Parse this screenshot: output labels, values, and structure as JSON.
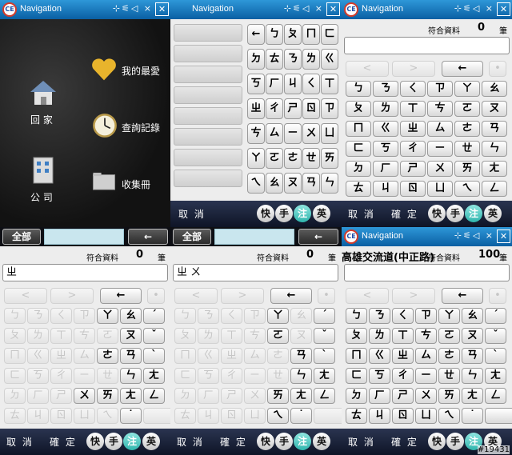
{
  "app": {
    "title": "Navigation",
    "logo": "CE",
    "close": "✕",
    "tray": "⊹⚟◁ ×"
  },
  "home": {
    "items": [
      {
        "label": "回 家",
        "icon": "house-icon"
      },
      {
        "label": "公 司",
        "icon": "building-icon"
      },
      {
        "label": "我的最愛",
        "icon": "heart-icon"
      },
      {
        "label": "查詢記錄",
        "icon": "clock-icon"
      },
      {
        "label": "收集冊",
        "icon": "folder-icon"
      }
    ]
  },
  "bottom": {
    "cancel": "取 消",
    "confirm": "確 定",
    "modes": [
      "快",
      "手",
      "注",
      "英"
    ],
    "active_mode": "注"
  },
  "count": {
    "label": "符合資料",
    "unit": "筆"
  },
  "topbar": {
    "all": "全部",
    "back": "←"
  },
  "panels": {
    "p2": {
      "keys": [
        "←",
        "ㄅ",
        "ㄆ",
        "ㄇ",
        "ㄈ",
        "ㄉ",
        "ㄊ",
        "ㄋ",
        "ㄌ",
        "ㄍ",
        "ㄎ",
        "ㄏ",
        "ㄐ",
        "ㄑ",
        "ㄒ",
        "ㄓ",
        "ㄔ",
        "ㄕ",
        "ㄖ",
        "ㄗ",
        "ㄘ",
        "ㄙ",
        "ㄧ",
        "ㄨ",
        "ㄩ",
        "ㄚ",
        "ㄛ",
        "ㄜ",
        "ㄝ",
        "ㄞ",
        "ㄟ",
        "ㄠ",
        "ㄡ",
        "ㄢ",
        "ㄣ"
      ]
    },
    "p3": {
      "count": "0",
      "input": "",
      "keys": [
        "<",
        ">",
        "←",
        "•",
        "ㄅ",
        "ㄋ",
        "ㄑ",
        "ㄗ",
        "ㄚ",
        "ㄠ",
        "ㄆ",
        "ㄌ",
        "ㄒ",
        "ㄘ",
        "ㄛ",
        "ㄡ",
        "ㄇ",
        "ㄍ",
        "ㄓ",
        "ㄙ",
        "ㄜ",
        "ㄢ",
        "ㄈ",
        "ㄎ",
        "ㄔ",
        "ㄧ",
        "ㄝ",
        "ㄣ",
        "ㄉ",
        "ㄏ",
        "ㄕ",
        "ㄨ",
        "ㄞ",
        "ㄤ",
        "ㄊ",
        "ㄐ",
        "ㄖ",
        "ㄩ",
        "ㄟ",
        "ㄥ"
      ]
    },
    "p4": {
      "count": "0",
      "input": "ㄓ",
      "enabled": [
        "ㄚ",
        "ㄠ",
        "ˊ",
        "ㄡ",
        "ˇ",
        "ㄜ",
        "ㄢ",
        "ˋ",
        "ㄣ",
        "ㄤ",
        "ㄨ",
        "ㄞ",
        "ㄥ",
        "˙"
      ],
      "keys": [
        "<",
        ">",
        "←",
        "•",
        "ㄅ",
        "ㄋ",
        "ㄑ",
        "ㄗ",
        "ㄚ",
        "ㄠ",
        "ˊ",
        "ㄆ",
        "ㄌ",
        "ㄒ",
        "ㄘ",
        "ㄛ",
        "ㄡ",
        "ˇ",
        "ㄇ",
        "ㄍ",
        "ㄓ",
        "ㄙ",
        "ㄜ",
        "ㄢ",
        "ˋ",
        "ㄈ",
        "ㄎ",
        "ㄔ",
        "ㄧ",
        "ㄝ",
        "ㄣ",
        "ㄤ",
        "ㄉ",
        "ㄏ",
        "ㄕ",
        "ㄨ",
        "ㄞ",
        "ㄤ",
        "ㄥ",
        "ㄊ",
        "ㄐ",
        "ㄖ",
        "ㄩ",
        "ㄟ",
        "˙",
        ""
      ]
    },
    "p5": {
      "count": "0",
      "input": "ㄓ ㄨ",
      "enabled": [
        "ㄚ",
        "ˊ",
        "ㄛ",
        "ˇ",
        "ㄢ",
        "ˋ",
        "ㄣ",
        "ㄞ",
        "ㄤ",
        "ㄥ",
        "ㄟ",
        "˙"
      ],
      "keys": [
        "<",
        ">",
        "←",
        "•",
        "ㄅ",
        "ㄋ",
        "ㄑ",
        "ㄗ",
        "ㄚ",
        "ㄠ",
        "ˊ",
        "ㄆ",
        "ㄌ",
        "ㄒ",
        "ㄘ",
        "ㄛ",
        "ㄡ",
        "ˇ",
        "ㄇ",
        "ㄍ",
        "ㄓ",
        "ㄙ",
        "ㄜ",
        "ㄢ",
        "ˋ",
        "ㄈ",
        "ㄎ",
        "ㄔ",
        "ㄧ",
        "ㄝ",
        "ㄣ",
        "ㄤ",
        "ㄉ",
        "ㄏ",
        "ㄕ",
        "ㄨ",
        "ㄞ",
        "ㄤ",
        "ㄥ",
        "ㄊ",
        "ㄐ",
        "ㄖ",
        "ㄩ",
        "ㄟ",
        "˙",
        ""
      ]
    },
    "p6": {
      "count": "100",
      "result": "高雄交流道(中正路)",
      "input": "",
      "keys": [
        "<",
        ">",
        "←",
        "•",
        "ㄅ",
        "ㄋ",
        "ㄑ",
        "ㄗ",
        "ㄚ",
        "ㄠ",
        "ˊ",
        "ㄆ",
        "ㄌ",
        "ㄒ",
        "ㄘ",
        "ㄛ",
        "ㄡ",
        "ˇ",
        "ㄇ",
        "ㄍ",
        "ㄓ",
        "ㄙ",
        "ㄜ",
        "ㄢ",
        "ˋ",
        "ㄈ",
        "ㄎ",
        "ㄔ",
        "ㄧ",
        "ㄝ",
        "ㄣ",
        "ㄤ",
        "ㄉ",
        "ㄏ",
        "ㄕ",
        "ㄨ",
        "ㄞ",
        "ㄤ",
        "ㄥ",
        "ㄊ",
        "ㄐ",
        "ㄖ",
        "ㄩ",
        "ㄟ",
        "˙",
        ""
      ]
    }
  },
  "watermark": "#19431"
}
